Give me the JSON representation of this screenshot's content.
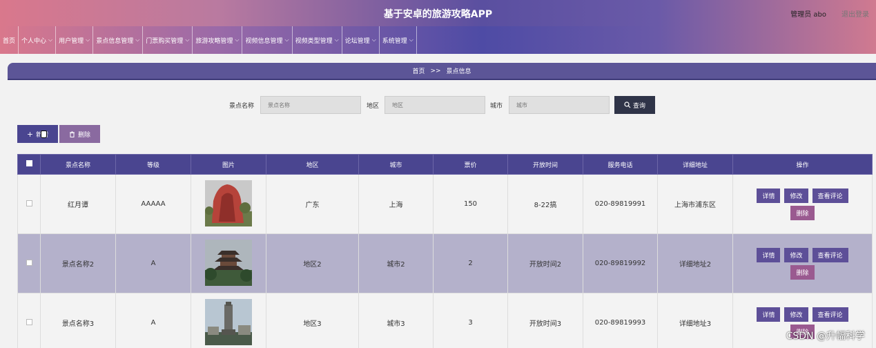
{
  "header": {
    "app_title": "基于安卓的旅游攻略APP",
    "user": "管理员 abo",
    "logout": "退出登录"
  },
  "nav": [
    "首页",
    "个人中心",
    "用户管理",
    "景点信息管理",
    "门票购买管理",
    "旅游攻略管理",
    "视频信息管理",
    "视频类型管理",
    "论坛管理",
    "系统管理"
  ],
  "breadcrumb": {
    "home": "首页",
    "sep": ">>",
    "current": "景点信息"
  },
  "search": {
    "name_label": "景点名称",
    "name_placeholder": "景点名称",
    "region_label": "地区",
    "region_placeholder": "地区",
    "city_label": "城市",
    "city_placeholder": "城市",
    "query_button": "查询"
  },
  "actions": {
    "add": "新增",
    "delete": "删除"
  },
  "table": {
    "headers": [
      "景点名称",
      "等级",
      "图片",
      "地区",
      "城市",
      "票价",
      "开放时间",
      "服务电话",
      "详细地址",
      "操作"
    ],
    "rows": [
      {
        "name": "红月谭",
        "level": "AAAAA",
        "region": "广东",
        "city": "上海",
        "price": "150",
        "hours": "8-22搞",
        "phone": "020-89819991",
        "address": "上海市浦东区"
      },
      {
        "name": "景点名称2",
        "level": "A",
        "region": "地区2",
        "city": "城市2",
        "price": "2",
        "hours": "开放时间2",
        "phone": "020-89819992",
        "address": "详细地址2"
      },
      {
        "name": "景点名称3",
        "level": "A",
        "region": "地区3",
        "city": "城市3",
        "price": "3",
        "hours": "开放时间3",
        "phone": "020-89819993",
        "address": "详细地址3"
      }
    ],
    "row_ops": {
      "detail": "详情",
      "edit": "修改",
      "reviews": "查看评论",
      "delete": "删除"
    }
  },
  "watermark": "CSDN @升幅科学",
  "colors": {
    "primary": "#4a4590",
    "dark_button": "#2f3448",
    "delete_button": "#9a5a90",
    "highlight_row": "#b4b1cb"
  }
}
